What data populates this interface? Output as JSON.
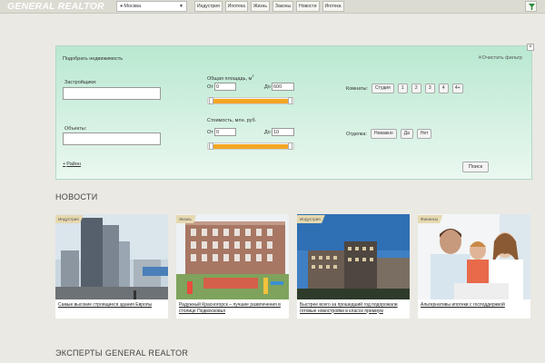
{
  "header": {
    "logo": "GENERAL REALTOR",
    "city": "Москва",
    "nav": [
      "Индустрия",
      "Ипотека",
      "Жизнь",
      "Законы",
      "Новости",
      "Иготека"
    ]
  },
  "search": {
    "title": "Подобрать недвижимость",
    "clear": "Очистить фильтр",
    "developers_label": "Застройщики:",
    "objects_label": "Объекты:",
    "area_label": "Общая площадь, м",
    "area_sup": "2",
    "from": "От",
    "to": "До",
    "area_from": "0",
    "area_to": "600",
    "price_label": "Стоимость, млн. руб.",
    "price_from": "0",
    "price_to": "10",
    "rooms_label": "Комнаты:",
    "rooms": [
      "Студия",
      "1",
      "2",
      "3",
      "4",
      "4+"
    ],
    "finish_label": "Отделка:",
    "finish_options": [
      "Неважно",
      "Да",
      "Нет"
    ],
    "district": "Район",
    "submit": "Поиск"
  },
  "news": {
    "title": "НОВОСТИ",
    "cards": [
      {
        "tag": "Индустрия",
        "title": "Самые высокие строящиеся здания Европы"
      },
      {
        "tag": "Жизнь",
        "title": "Радужный Красногорск – лучшие развлечения в столице Подмосковья"
      },
      {
        "tag": "Индустрия",
        "title": "Быстрее всего за прошедший год подорожали готовые новостройки в классе премиум"
      },
      {
        "tag": "Финансы",
        "title": "Альтернативы ипотеки с господдержкой"
      }
    ]
  },
  "experts": {
    "title": "ЭКСПЕРТЫ GENERAL REALTOR"
  },
  "colors": {
    "background": "#eae9e3",
    "panel": "#c8eedb",
    "slider_fill": "#f5a623",
    "logo": "#ffffff"
  }
}
